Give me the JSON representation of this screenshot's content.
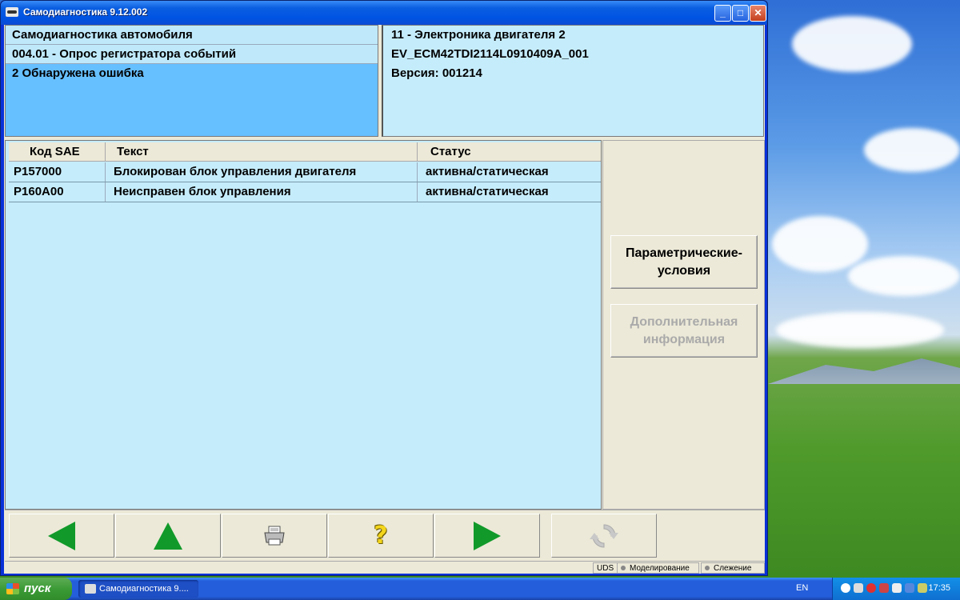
{
  "window": {
    "title": "Самодиагностика 9.12.002",
    "min_label": "_",
    "max_label": "□",
    "close_label": "✕"
  },
  "header_left": {
    "rows": [
      "Самодиагностика автомобиля",
      "004.01 - Опрос регистратора событий",
      "2 Обнаружена ошибка"
    ]
  },
  "header_right": {
    "rows": [
      "11 - Электроника двигателя 2",
      "EV_ECM42TDI2114L0910409A_001",
      "Версия: 001214"
    ]
  },
  "table": {
    "columns": [
      "Код SAE",
      "Текст",
      "Статус"
    ],
    "rows": [
      {
        "code": "P157000",
        "text": "Блокирован блок управления двигателя",
        "status": "активна/статическая"
      },
      {
        "code": "P160A00",
        "text": "Неисправен блок управления",
        "status": "активна/статическая"
      }
    ]
  },
  "side_buttons": {
    "parametric": {
      "line1": "Параметрические-",
      "line2": "условия"
    },
    "additional": {
      "line1": "Дополнительная",
      "line2": "информация"
    }
  },
  "nav": {
    "icons": [
      "arrow-left-icon",
      "arrow-up-icon",
      "print-icon",
      "help-icon",
      "arrow-right-icon",
      "refresh-icon"
    ]
  },
  "statusbar": {
    "protocol": "UDS",
    "simulation": "Моделирование",
    "tracking": "Слежение"
  },
  "taskbar": {
    "start_label": "пуск",
    "task_item": "Самодиагностика 9....",
    "lang": "EN",
    "clock": "17:35"
  },
  "colors": {
    "header_selected": "#66bfff",
    "panel_bg": "#c5ecfb",
    "arrow_green": "#119a2a",
    "help_yellow": "#f3d51b"
  }
}
